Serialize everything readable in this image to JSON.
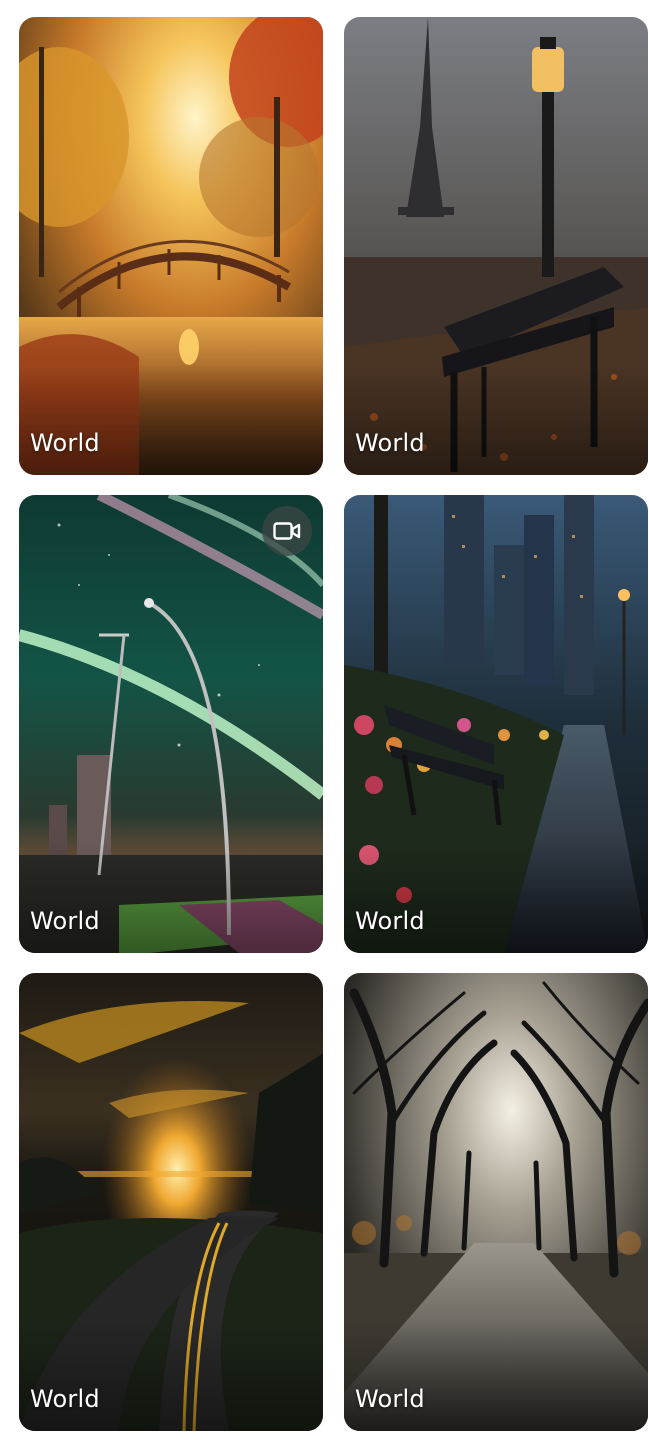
{
  "cards": [
    {
      "label": "World",
      "scene": "autumn bridge over pond at sunrise",
      "video": false
    },
    {
      "label": "World",
      "scene": "rainy park bench near eiffel tower",
      "video": false
    },
    {
      "label": "World",
      "scene": "aurora over city street with lamp posts",
      "video": true,
      "badge_icon": "video-camera-icon"
    },
    {
      "label": "World",
      "scene": "city park walkway with flowers at night",
      "video": false
    },
    {
      "label": "World",
      "scene": "winding road toward sunset",
      "video": false
    },
    {
      "label": "World",
      "scene": "tree-lined cobblestone path in misty light",
      "video": false
    }
  ]
}
